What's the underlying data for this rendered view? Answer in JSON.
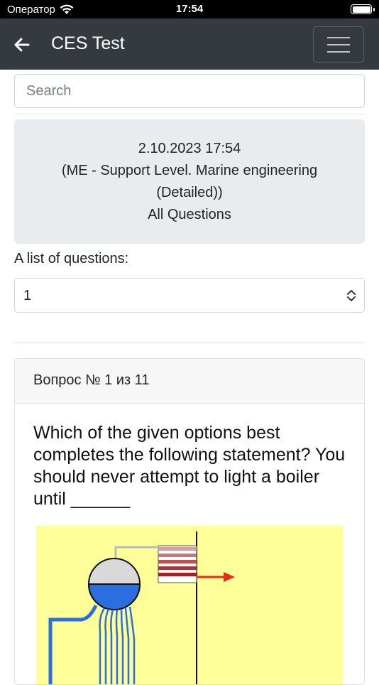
{
  "status_bar": {
    "carrier": "Оператор",
    "time": "17:54"
  },
  "navbar": {
    "title": "CES Test"
  },
  "search": {
    "placeholder": "Search"
  },
  "info_box": {
    "date": "2.10.2023 17:54",
    "course_line1": "(ME - Support Level. Marine engineering",
    "course_line2": "(Detailed))",
    "mode": "All Questions"
  },
  "question_list": {
    "label": "A list of questions:",
    "selected": "1"
  },
  "question_card": {
    "header": "Вопрос № 1 из 11",
    "text": "Which of the given options best completes the following statement? You should never attempt to light a boiler until ______"
  },
  "colors": {
    "navbar_bg": "#343a40",
    "info_bg": "#e9ecef",
    "diagram_bg": "#ffff99",
    "water": "#2a6ee0",
    "flue_arrow": "#e8291c"
  },
  "icons": [
    "wifi-icon",
    "battery-icon",
    "back-arrow-icon",
    "menu-icon",
    "select-chevron-icon"
  ]
}
